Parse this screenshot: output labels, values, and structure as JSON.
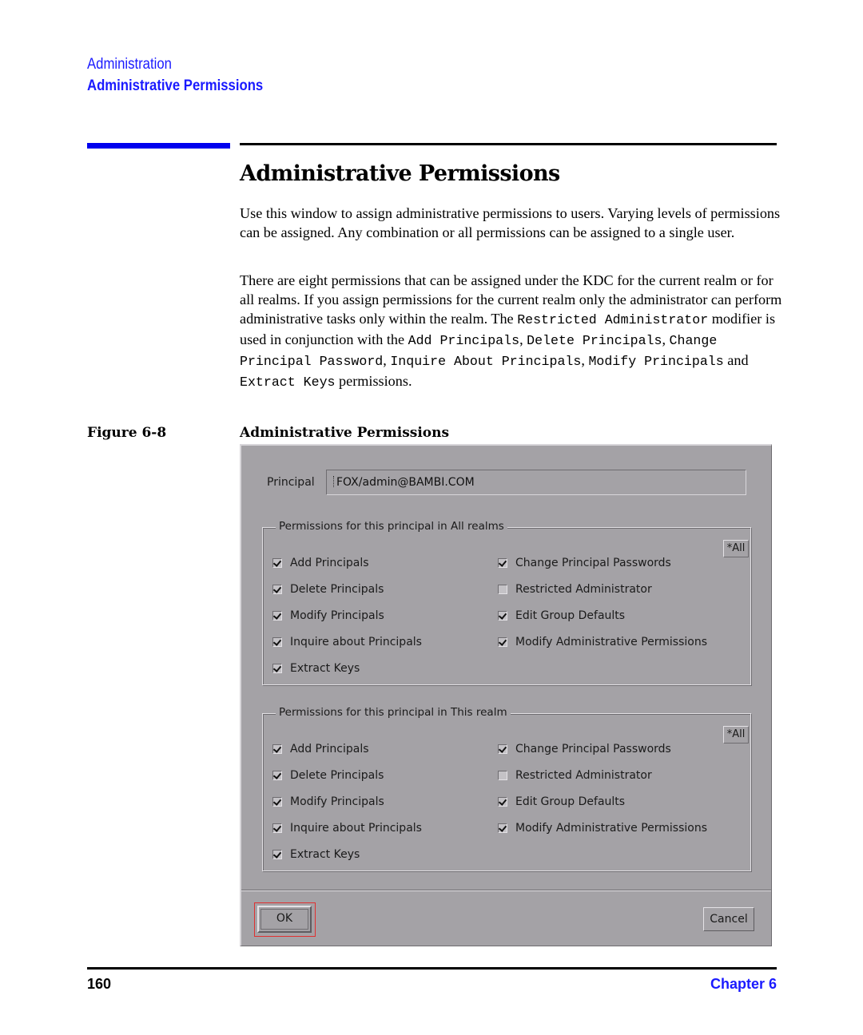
{
  "running_head": {
    "chapter_title": "Administration",
    "section_title": "Administrative Permissions"
  },
  "section": {
    "title": "Administrative Permissions",
    "para1": "Use this window to assign administrative permissions to users. Varying levels of permissions can be assigned. Any combination or all permissions can be assigned to a single user.",
    "para2": {
      "t1": "There are eight permissions that can be assigned under the KDC for the current realm or for all realms. If you assign permissions for the current realm only the administrator can perform administrative tasks only within the realm. The ",
      "c1": "Restricted Administrator",
      "t2": " modifier is used in conjunction with the ",
      "c2": "Add Principals",
      "t3": ", ",
      "c3": "Delete Principals",
      "t4": ", ",
      "c4": "Change Principal Password",
      "t5": ", ",
      "c5": "Inquire About Principals",
      "t6": ", ",
      "c6": "Modify Principals",
      "t7": " and ",
      "c7": "Extract Keys",
      "t8": " permissions."
    }
  },
  "figure": {
    "label": "Figure 6-8",
    "title": "Administrative Permissions"
  },
  "dialog": {
    "principal_label": "Principal",
    "principal_value": "FOX/admin@BAMBI.COM",
    "groups": [
      {
        "legend": "Permissions for this principal in All realms",
        "all_button": "*All",
        "left": [
          {
            "label": "Add Principals",
            "checked": true
          },
          {
            "label": "Delete Principals",
            "checked": true
          },
          {
            "label": "Modify Principals",
            "checked": true
          },
          {
            "label": "Inquire about Principals",
            "checked": true
          },
          {
            "label": "Extract Keys",
            "checked": true
          }
        ],
        "right": [
          {
            "label": "Change Principal Passwords",
            "checked": true
          },
          {
            "label": "Restricted Administrator",
            "checked": false
          },
          {
            "label": "Edit Group Defaults",
            "checked": true
          },
          {
            "label": "Modify Administrative Permissions",
            "checked": true
          }
        ]
      },
      {
        "legend": "Permissions for this principal in This realm",
        "all_button": "*All",
        "left": [
          {
            "label": "Add Principals",
            "checked": true
          },
          {
            "label": "Delete Principals",
            "checked": true
          },
          {
            "label": "Modify Principals",
            "checked": true
          },
          {
            "label": "Inquire about Principals",
            "checked": true
          },
          {
            "label": "Extract Keys",
            "checked": true
          }
        ],
        "right": [
          {
            "label": "Change Principal Passwords",
            "checked": true
          },
          {
            "label": "Restricted Administrator",
            "checked": false
          },
          {
            "label": "Edit Group Defaults",
            "checked": true
          },
          {
            "label": "Modify Administrative Permissions",
            "checked": true
          }
        ]
      }
    ],
    "ok_label": "OK",
    "cancel_label": "Cancel"
  },
  "footer": {
    "page_number": "160",
    "chapter": "Chapter 6"
  },
  "colors": {
    "accent_blue": "#1a1aff",
    "dialog_bg": "#a4a2a6",
    "highlight_red": "#e03030"
  }
}
